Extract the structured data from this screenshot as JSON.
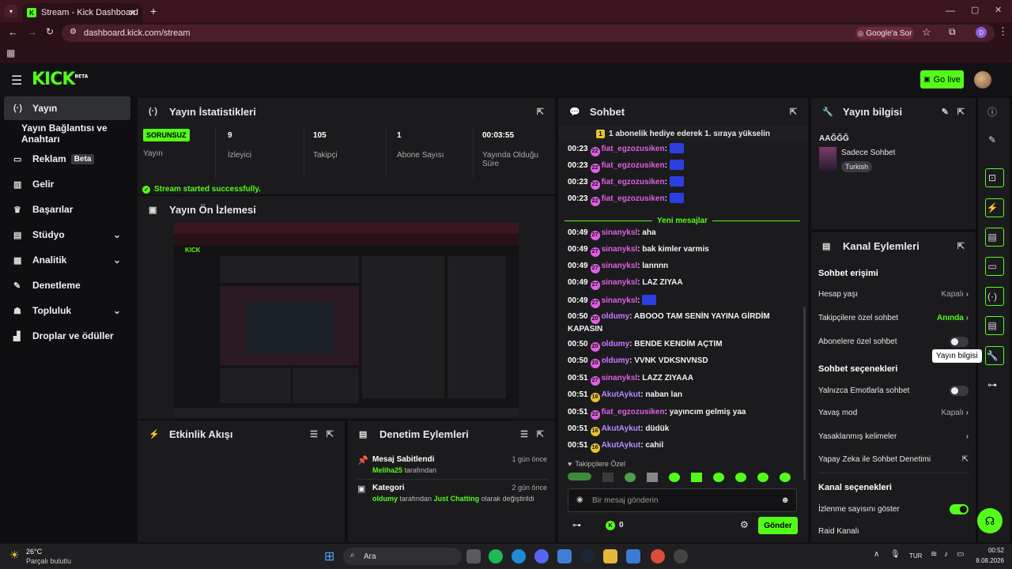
{
  "browser": {
    "tab_title": "Stream - Kick Dashboard",
    "url": "dashboard.kick.com/stream",
    "google_button": "Google'a Sor",
    "profile_initial": "D"
  },
  "topbar": {
    "logo": "KICK",
    "logo_sup": "BETA",
    "go_live": "Go live"
  },
  "sidebar": {
    "items": [
      {
        "label": "Yayın",
        "icon": "broadcast-icon"
      },
      {
        "label": "Yayın Bağlantısı ve Anahtarı"
      },
      {
        "label": "Reklam",
        "badge": "Beta"
      },
      {
        "label": "Gelir"
      },
      {
        "label": "Başarılar"
      },
      {
        "label": "Stüdyo"
      },
      {
        "label": "Analitik"
      },
      {
        "label": "Denetleme"
      },
      {
        "label": "Topluluk"
      },
      {
        "label": "Droplar ve ödüller"
      }
    ]
  },
  "stats": {
    "title": "Yayın İstatistikleri",
    "status_badge": "SORUNSUZ",
    "status_label": "Yayın",
    "viewers_value": "9",
    "viewers_label": "İzleyici",
    "followers_value": "105",
    "followers_label": "Takipçi",
    "subs_value": "1",
    "subs_label": "Abone Sayısı",
    "uptime_value": "00:03:55",
    "uptime_label": "Yayında Olduğu Süre",
    "success_message": "Stream started successfully."
  },
  "preview": {
    "title": "Yayın Ön İzlemesi"
  },
  "activity": {
    "title": "Etkinlik Akışı"
  },
  "moderation": {
    "title": "Denetim Eylemleri",
    "items": [
      {
        "title": "Mesaj Sabitlendi",
        "time": "1 gün önce",
        "user": "Meliha25",
        "suffix": " tarafından"
      },
      {
        "title": "Kategori",
        "time": "2 gün önce",
        "user": "oldumy",
        "mid": " tarafından ",
        "category": "Just Chatting",
        "suffix": " olarak değiştirildi"
      }
    ]
  },
  "chat": {
    "title": "Sohbet",
    "gift_banner": "1 abonelik hediye ederek 1. sıraya yükselin",
    "new_messages": "Yeni mesajlar",
    "followers_only": "Takipçilere Özel",
    "input_placeholder": "Bir mesaj gönderin",
    "points": "0",
    "send": "Gönder",
    "messages": [
      {
        "time": "00:23",
        "badge": "22",
        "user": "fiat_egzozusiken",
        "text": "",
        "emote": true,
        "color": "#e15fe3"
      },
      {
        "time": "00:23",
        "badge": "22",
        "user": "fiat_egzozusiken",
        "text": "",
        "emote": true,
        "color": "#e15fe3"
      },
      {
        "time": "00:23",
        "badge": "22",
        "user": "fiat_egzozusiken",
        "text": "",
        "emote": true,
        "color": "#e15fe3"
      },
      {
        "time": "00:23",
        "badge": "22",
        "user": "fiat_egzozusiken",
        "text": "",
        "emote": true,
        "color": "#e15fe3"
      },
      {
        "time": "00:49",
        "badge": "27",
        "user": "sinanyksl",
        "text": "aha",
        "color": "#e15fe3"
      },
      {
        "time": "00:49",
        "badge": "27",
        "user": "sinanyksl",
        "text": "bak kimler varmis",
        "color": "#e15fe3"
      },
      {
        "time": "00:49",
        "badge": "27",
        "user": "sinanyksl",
        "text": "lannnn",
        "color": "#e15fe3"
      },
      {
        "time": "00:49",
        "badge": "27",
        "user": "sinanyksl",
        "text": "LAZ ZIYAA",
        "color": "#e15fe3"
      },
      {
        "time": "00:49",
        "badge": "27",
        "user": "sinanyksl",
        "text": "",
        "emote": true,
        "color": "#e15fe3"
      },
      {
        "time": "00:50",
        "badge": "20",
        "user": "oldumy",
        "text": "ABOOO TAM SENİN YAYINA GİRDİM KAPASIN",
        "color": "#c77dff"
      },
      {
        "time": "00:50",
        "badge": "20",
        "user": "oldumy",
        "text": "BENDE KENDİM AÇTIM",
        "color": "#c77dff"
      },
      {
        "time": "00:50",
        "badge": "20",
        "user": "oldumy",
        "text": "VVNK VDKSNVNSD",
        "color": "#c77dff"
      },
      {
        "time": "00:51",
        "badge": "27",
        "user": "sinanyksl",
        "text": "LAZZ ZIYAAA",
        "color": "#e15fe3"
      },
      {
        "time": "00:51",
        "badge": "16",
        "user": "AkutAykut",
        "text": "naban lan",
        "color": "#b48cff"
      },
      {
        "time": "00:51",
        "badge": "22",
        "user": "fiat_egzozusiken",
        "text": "yayıncım gelmiş yaa",
        "color": "#e15fe3"
      },
      {
        "time": "00:51",
        "badge": "16",
        "user": "AkutAykut",
        "text": "düdük",
        "color": "#b48cff"
      },
      {
        "time": "00:51",
        "badge": "16",
        "user": "AkutAykut",
        "text": "cahil",
        "color": "#b48cff"
      }
    ]
  },
  "info": {
    "title": "Yayın bilgisi",
    "stream_title": "AAĞĞĞ",
    "category": "Sadece Sohbet",
    "language": "Turkish"
  },
  "actions": {
    "title": "Kanal Eylemleri",
    "chat_access": "Sohbet erişimi",
    "account_age": "Hesap yaşı",
    "account_age_value": "Kapalı",
    "followers_chat": "Takipçilere özel sohbet",
    "followers_chat_value": "Anında",
    "subs_chat": "Abonelere özel sohbet",
    "chat_options": "Sohbet seçenekleri",
    "emote_only": "Yalnızca Emotlarla sohbet",
    "slow_mode": "Yavaş mod",
    "slow_mode_value": "Kapalı",
    "banned_words": "Yasaklanmış kelimeler",
    "ai_mod": "Yapay Zeka ile Sohbet Denetimi",
    "channel_options": "Kanal seçenekleri",
    "show_viewers": "İzlenme sayısını göster",
    "raid": "Raid Kanalı"
  },
  "tooltip": "Yayın bilgisi",
  "taskbar": {
    "weather_temp": "26°C",
    "weather_desc": "Parçalı bulutlu",
    "search": "Ara",
    "lang": "TUR",
    "time": "00:52",
    "date": "8.08.2026"
  },
  "colors": {
    "accent": "#53fc18",
    "panel": "#1b1b1e",
    "browser": "#3b1620"
  }
}
